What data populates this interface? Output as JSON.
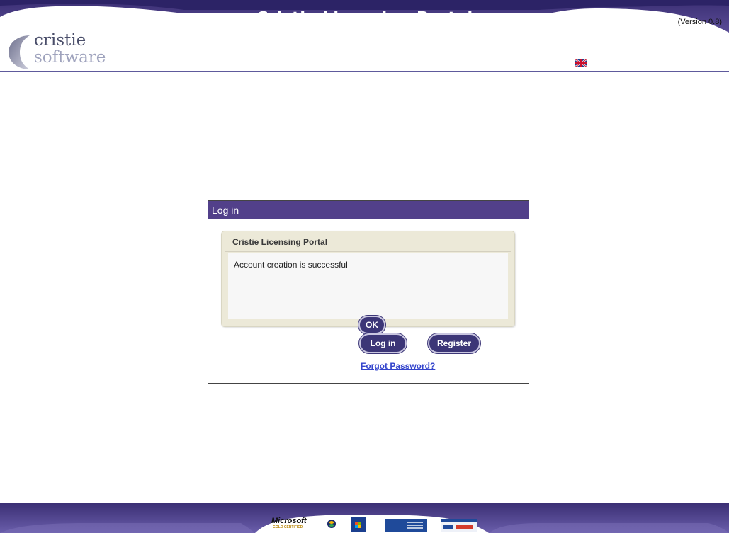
{
  "header": {
    "title": "Cristie Licensing Portal",
    "version": "(Version 0.8)",
    "logo_line1": "cristie",
    "logo_line2": "software",
    "language_flag": "uk-flag-icon"
  },
  "login_panel": {
    "title": "Log in",
    "message_box": {
      "title": "Cristie Licensing Portal",
      "message": "Account creation is successful",
      "ok_label": "OK"
    },
    "login_label": "Log in",
    "register_label": "Register",
    "forgot_label": "Forgot Password?"
  },
  "footer": {
    "microsoft_label": "Microsoft",
    "microsoft_sub": "GOLD CERTIFIED",
    "badges": [
      "microsoft-gold-certified-badge",
      "compatible-badge",
      "windows-badge",
      "ibm-advanced-partner-badge",
      "ibm-tivoli-badge"
    ]
  },
  "colors": {
    "brand_purple": "#52408a",
    "button_purple": "#3c3677",
    "link_blue": "#3344cc"
  }
}
